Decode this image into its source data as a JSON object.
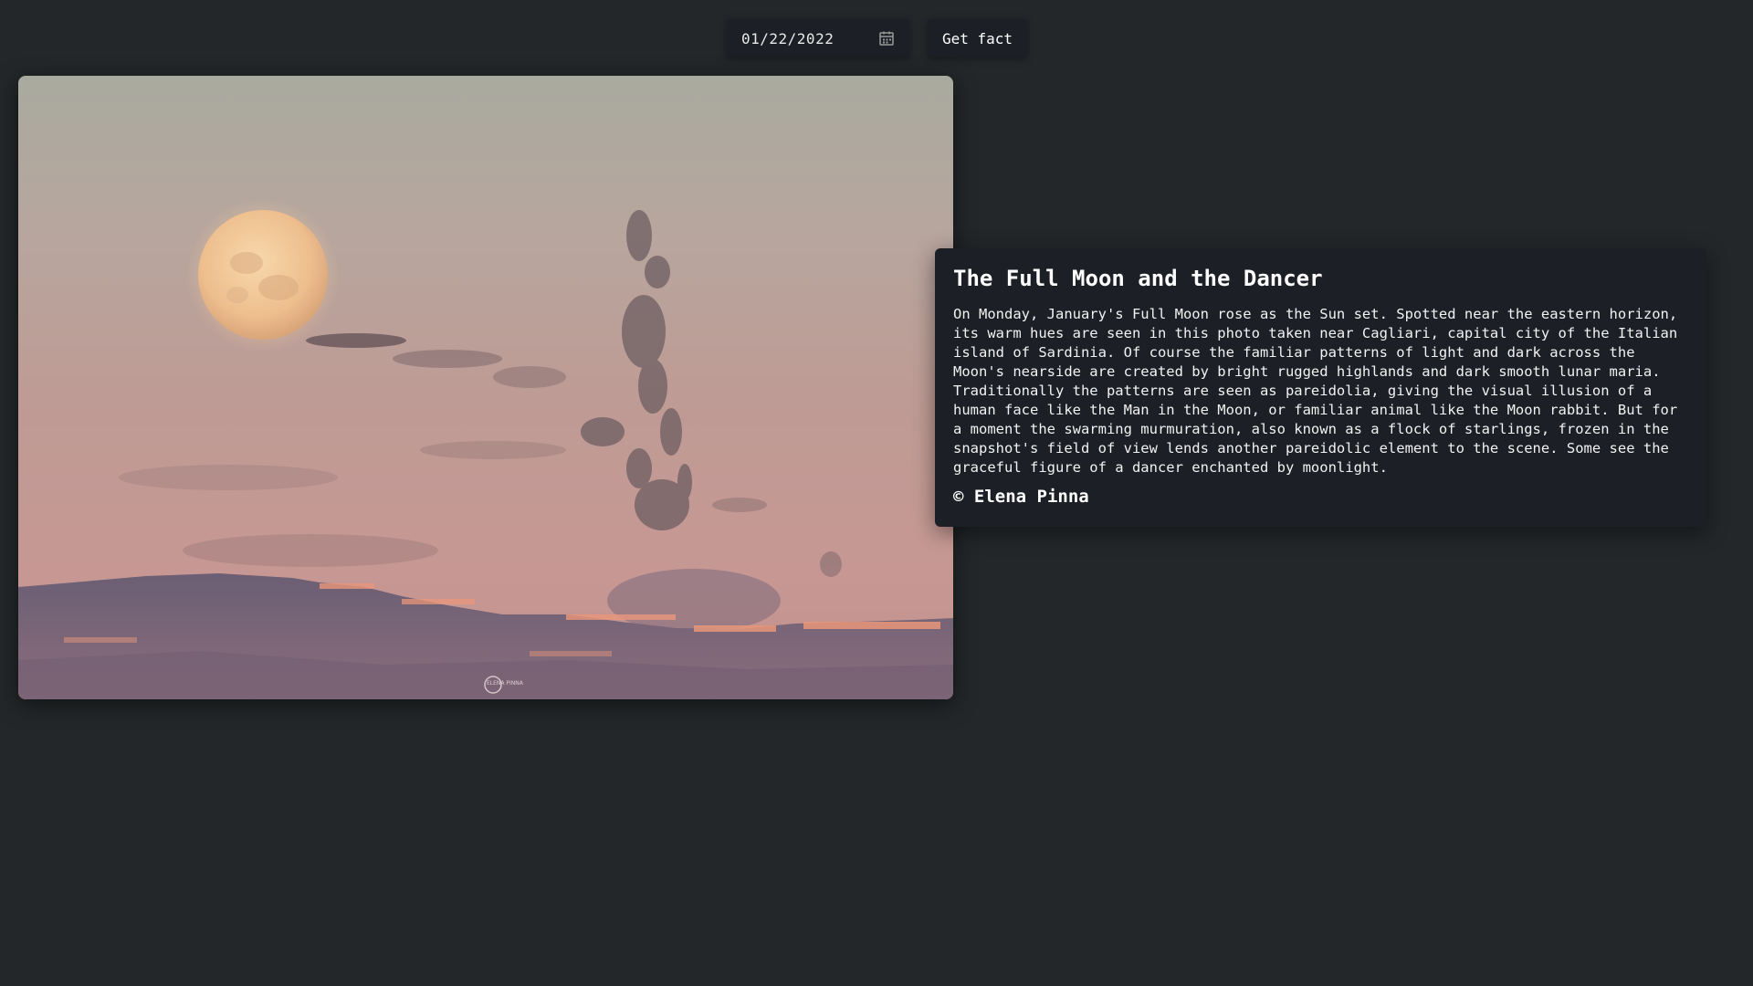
{
  "controls": {
    "date_value": "01/22/2022",
    "calendar_icon": "calendar-icon",
    "get_fact_label": "Get fact"
  },
  "photo": {
    "watermark": "ELENA PINNA"
  },
  "fact": {
    "title": "The Full Moon and the Dancer",
    "explanation": "On Monday, January's Full Moon rose as the Sun set. Spotted near the eastern horizon, its warm hues are seen in this photo taken near Cagliari, capital city of the Italian island of Sardinia. Of course the familiar patterns of light and dark across the Moon's nearside are created by bright rugged highlands and dark smooth lunar maria. Traditionally the patterns are seen as pareidolia, giving the visual illusion of a human face like the Man in the Moon, or familiar animal like the Moon rabbit. But for a moment the swarming murmuration, also known as a flock of starlings, frozen in the snapshot's field of view lends another pareidolic element to the scene. Some see the graceful figure of a dancer enchanted by moonlight.",
    "credit": "© Elena Pinna"
  },
  "colors": {
    "background": "#232729",
    "panel": "#1c1f26",
    "text": "#ffffff"
  }
}
